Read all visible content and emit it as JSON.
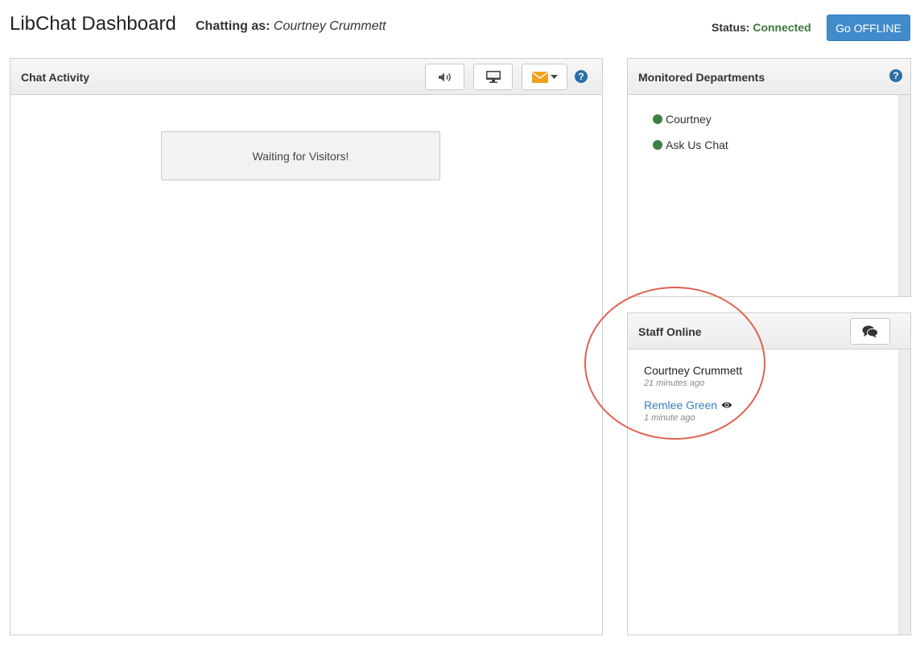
{
  "header": {
    "title": "LibChat Dashboard",
    "chatting_label": "Chatting as:",
    "chatting_name": "Courtney Crummett",
    "status_label": "Status:",
    "status_value": "Connected",
    "go_offline_label": "Go OFFLINE"
  },
  "chat_activity": {
    "title": "Chat Activity",
    "waiting_text": "Waiting for Visitors!",
    "toolbar_icons": [
      "volume-icon",
      "desktop-icon",
      "envelope-icon",
      "caret-down-icon",
      "help-icon"
    ],
    "help_glyph": "?"
  },
  "departments": {
    "title": "Monitored Departments",
    "help_glyph": "?",
    "items": [
      {
        "label": "Courtney",
        "status_color": "#3f7f3f"
      },
      {
        "label": "Ask Us Chat",
        "status_color": "#3f7f3f"
      }
    ]
  },
  "staff_online": {
    "title": "Staff Online",
    "chat_icon": "comments-icon",
    "staff": [
      {
        "name": "Courtney Crummett",
        "time": "21 minutes ago"
      },
      {
        "name": "Remlee Green",
        "time": "1 minute ago",
        "icon": "eye-icon"
      }
    ]
  },
  "colors": {
    "accent": "#428bca",
    "connected": "#3c763d",
    "envelope": "#f0a01a",
    "link": "#3a7fc1",
    "annotation": "#e06050"
  }
}
